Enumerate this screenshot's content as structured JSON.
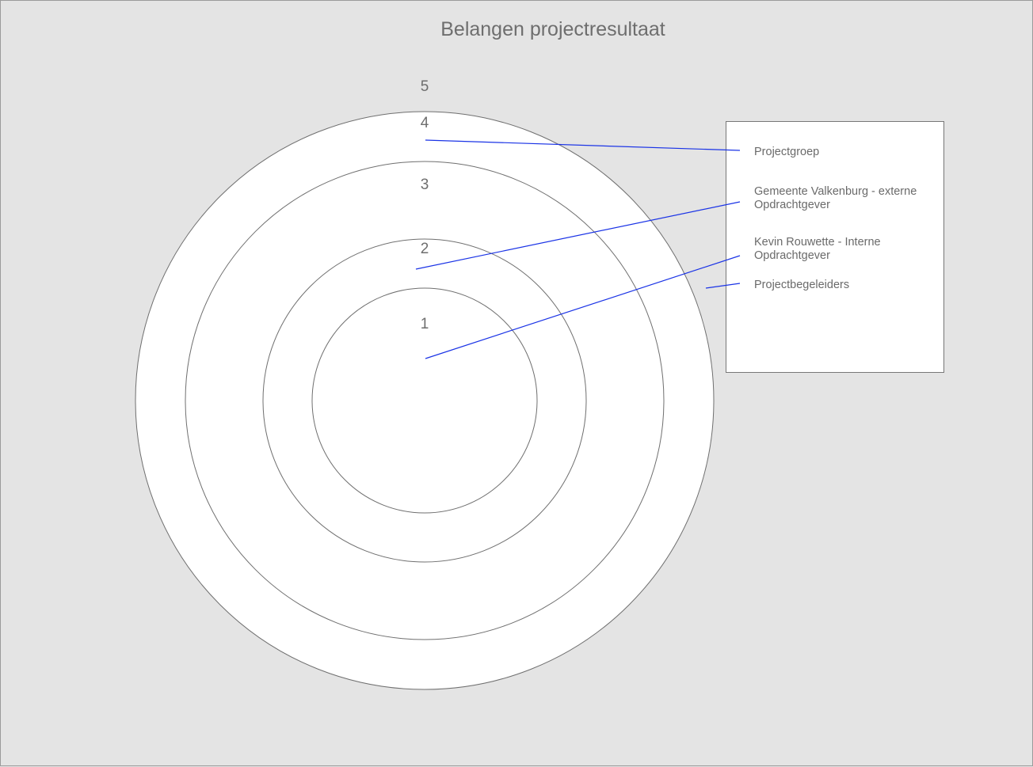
{
  "title": "Belangen projectresultaat",
  "rings": [
    {
      "label": "5"
    },
    {
      "label": "4"
    },
    {
      "label": "3"
    },
    {
      "label": "2"
    },
    {
      "label": "1"
    }
  ],
  "stakeholders": [
    {
      "line1": "Projectgroep",
      "line2": "",
      "ring": "4"
    },
    {
      "line1": "Gemeente Valkenburg - externe",
      "line2": "Opdrachtgever",
      "ring": "2"
    },
    {
      "line1": "Kevin Rouwette - Interne",
      "line2": "Opdrachtgever",
      "ring": "1"
    },
    {
      "line1": "Projectbegeleiders",
      "line2": "",
      "ring": "5"
    }
  ],
  "colors": {
    "background": "#e4e4e4",
    "ring_fill": "#ffffff",
    "ring_stroke": "#6f6f6f",
    "connector": "#1a33e6",
    "text": "#6e6e6e"
  }
}
